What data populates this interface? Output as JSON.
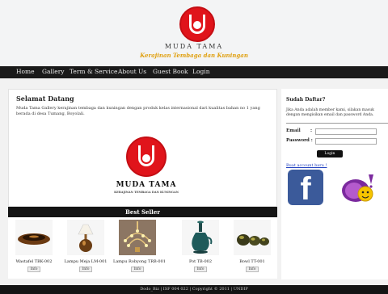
{
  "header": {
    "brand": "MUDA TAMA",
    "tagline": "Kerajinan Tembaga dan Kuningan"
  },
  "nav": {
    "items": [
      "Home",
      "Gallery",
      "Term & Service",
      "About Us",
      "Guest Book",
      "Login"
    ]
  },
  "welcome": {
    "title": "Selamat Datang",
    "text": "Muda Tama Gallery kerajinan tembaga dan kuningan dengan produk kelas internasional dari kualitas bahan no 1 yang berada di desa Tumang, Boyolali.",
    "logo_brand": "MUDA TAMA",
    "logo_sub": "KERAJINAN TEMBAGA DAN KUNINGAN"
  },
  "best_seller": {
    "title": "Best Seller",
    "info_label": "Info",
    "products": [
      {
        "name": "Wastafel TBK-002",
        "icon": "sink-bowl-icon"
      },
      {
        "name": "Lampu Meja LM-001",
        "icon": "table-lamp-icon"
      },
      {
        "name": "Lampu Robyong TRB-001",
        "icon": "chandelier-icon"
      },
      {
        "name": "Pot TB-002",
        "icon": "vase-icon"
      },
      {
        "name": "Bowl TT-001",
        "icon": "bowl-set-icon"
      }
    ]
  },
  "sidebar": {
    "title": "Sudah Daftar?",
    "description": "Jika Anda adalah member kami, silakan masuk dengan mengisikan email dan password Anda.",
    "email_label": "Email",
    "password_label": "Password :",
    "login_button": "Login",
    "signup_link": "Buat account baru !"
  },
  "footer": {
    "text": "Dodo_Biz | ISF 004 022 | Copyright © 2011 | UNDIP"
  },
  "colors": {
    "brand_red": "#e0141b",
    "nav_bg": "#1a1a1a",
    "tagline_gold": "#e0a010",
    "facebook_blue": "#3b5a9a"
  }
}
